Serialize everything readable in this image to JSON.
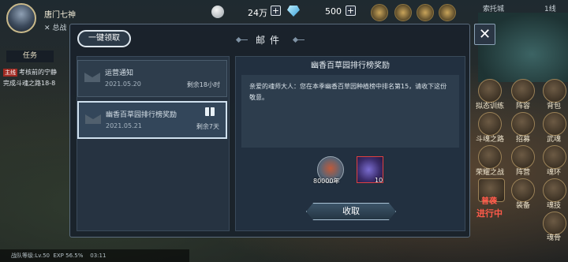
{
  "player": {
    "name": "唐门七神",
    "guild": "✕ 总战"
  },
  "currency": {
    "silver": "24万",
    "diamond": "500",
    "plus": "+"
  },
  "task": {
    "tab": "任务",
    "tag": "主线",
    "line1": "考核前的宁静",
    "line2": "完成斗魂之路18-8"
  },
  "map": {
    "region": "索托城",
    "line": "1线"
  },
  "side_menu": [
    {
      "label": "拟态训练"
    },
    {
      "label": "阵容"
    },
    {
      "label": "背包"
    },
    {
      "label": "斗魂之路"
    },
    {
      "label": "招募"
    },
    {
      "label": "武魂"
    },
    {
      "label": "荣耀之战"
    },
    {
      "label": "阵营"
    },
    {
      "label": "魂环"
    },
    {
      "label": "装备"
    },
    {
      "label": "魂技"
    },
    {
      "label": "魂骨"
    }
  ],
  "battle_status": {
    "line1": "普袭",
    "line2": "进行中"
  },
  "status_bar": {
    "level": "战队等级:Lv.50",
    "exp": "EXP 56.5%",
    "time": "03:11"
  },
  "mail": {
    "title": "邮件",
    "claim_all": "一键领取",
    "close": "✕",
    "items": [
      {
        "title": "运营通知",
        "date": "2021.05.20",
        "remaining": "剩余18小时"
      },
      {
        "title": "幽香百草园排行榜奖励",
        "date": "2021.05.21",
        "remaining": "剩余7天"
      }
    ],
    "detail": {
      "title": "幽香百草园排行榜奖励",
      "body": "亲爱的魂师大人：您在本季幽香百草园种植榜中排名第15，请收下这份敬意。",
      "rewards": [
        {
          "qty": "80000年"
        },
        {
          "qty": "10"
        }
      ],
      "receive": "收取"
    }
  }
}
